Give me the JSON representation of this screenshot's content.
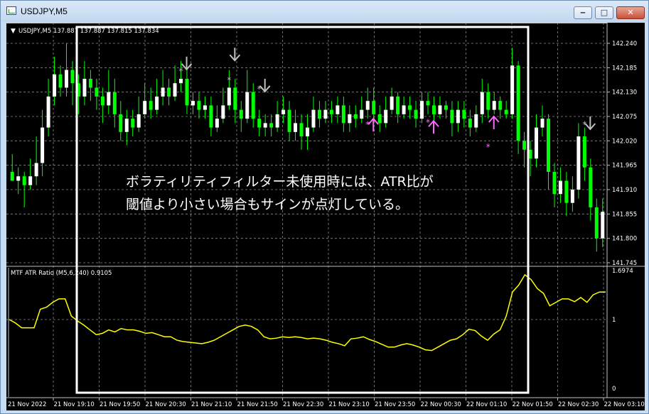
{
  "window": {
    "title": "USDJPY,M5",
    "minimize_glyph": "‒",
    "maximize_glyph": "□",
    "close_glyph": "✕"
  },
  "main_chart": {
    "header": "USDJPY,M5  137.887 137.887 137.815 137.834",
    "price_labels": [
      "142.240",
      "142.185",
      "142.130",
      "142.075",
      "142.020",
      "141.965",
      "141.910",
      "141.855",
      "141.800",
      "141.745"
    ]
  },
  "indicator": {
    "header": "MTF ATR Ratio  (M5,6,240) 0.9105",
    "scale_labels": [
      "1.6974",
      "1",
      "0"
    ],
    "line_color": "#ffff00"
  },
  "time_labels": [
    "21 Nov 2022",
    "21 Nov 19:10",
    "21 Nov 19:50",
    "21 Nov 20:30",
    "21 Nov 21:10",
    "21 Nov 21:50",
    "21 Nov 22:30",
    "21 Nov 23:10",
    "21 Nov 23:50",
    "22 Nov 00:30",
    "22 Nov 01:10",
    "22 Nov 01:50",
    "22 Nov 02:30",
    "22 Nov 03:10"
  ],
  "annotation": {
    "line1": "ボラティリティフィルター未使用時には、ATR比が",
    "line2": "閾値より小さい場合もサインが点灯している。"
  },
  "colors": {
    "bull_candle": "#ffffff",
    "bear_candle": "#00ff00",
    "grid": "#8a8a8a",
    "sell_arrow": "#c0c0c0",
    "buy_arrow": "#ff66ff",
    "highlight_box": "#ffffff"
  },
  "candles": [
    [
      141.95,
      141.93,
      141.99,
      141.93
    ],
    [
      141.93,
      141.94,
      141.96,
      141.9
    ],
    [
      141.94,
      141.92,
      141.95,
      141.87
    ],
    [
      141.92,
      141.94,
      141.98,
      141.91
    ],
    [
      141.94,
      141.97,
      142.03,
      141.92
    ],
    [
      141.97,
      142.05,
      142.09,
      141.94
    ],
    [
      142.05,
      142.12,
      142.16,
      142.03
    ],
    [
      142.12,
      142.17,
      142.21,
      142.1
    ],
    [
      142.17,
      142.14,
      142.19,
      142.12
    ],
    [
      142.14,
      142.18,
      142.24,
      142.12
    ],
    [
      142.18,
      142.15,
      142.2,
      142.1
    ],
    [
      142.15,
      142.12,
      142.17,
      142.08
    ],
    [
      142.12,
      142.16,
      142.2,
      142.1
    ],
    [
      142.16,
      142.14,
      142.18,
      142.11
    ],
    [
      142.14,
      142.12,
      142.16,
      142.09
    ],
    [
      142.12,
      142.1,
      142.14,
      142.06
    ],
    [
      142.1,
      142.13,
      142.18,
      142.08
    ],
    [
      142.13,
      142.08,
      142.16,
      142.05
    ],
    [
      142.08,
      142.04,
      142.11,
      142.02
    ],
    [
      142.04,
      142.07,
      142.09,
      142.01
    ],
    [
      142.07,
      142.05,
      142.09,
      142.03
    ],
    [
      142.05,
      142.08,
      142.12,
      142.04
    ],
    [
      142.08,
      142.11,
      142.15,
      142.07
    ],
    [
      142.11,
      142.09,
      142.14,
      142.07
    ],
    [
      142.09,
      142.12,
      142.16,
      142.08
    ],
    [
      142.12,
      142.14,
      142.18,
      142.1
    ],
    [
      142.14,
      142.12,
      142.16,
      142.1
    ],
    [
      142.12,
      142.15,
      142.19,
      142.11
    ],
    [
      142.15,
      142.16,
      142.2,
      142.13
    ],
    [
      142.16,
      142.1,
      142.18,
      142.08
    ],
    [
      142.1,
      142.11,
      142.13,
      142.08
    ],
    [
      142.11,
      142.09,
      142.13,
      142.07
    ],
    [
      142.09,
      142.1,
      142.12,
      142.07
    ],
    [
      142.1,
      142.05,
      142.12,
      142.03
    ],
    [
      142.05,
      142.07,
      142.1,
      142.04
    ],
    [
      142.07,
      142.1,
      142.14,
      142.06
    ],
    [
      142.1,
      142.14,
      142.18,
      142.09
    ],
    [
      142.14,
      142.09,
      142.16,
      142.06
    ],
    [
      142.09,
      142.07,
      142.11,
      142.04
    ],
    [
      142.07,
      142.13,
      142.18,
      142.06
    ],
    [
      142.13,
      142.07,
      142.15,
      142.05
    ],
    [
      142.07,
      142.05,
      142.09,
      142.03
    ],
    [
      142.05,
      142.06,
      142.08,
      142.03
    ],
    [
      142.06,
      142.05,
      142.08,
      142.03
    ],
    [
      142.05,
      142.08,
      142.11,
      142.04
    ],
    [
      142.08,
      142.09,
      142.12,
      142.06
    ],
    [
      142.09,
      142.04,
      142.11,
      142.02
    ],
    [
      142.04,
      142.06,
      142.09,
      142.02
    ],
    [
      142.06,
      142.03,
      142.08,
      142.0
    ],
    [
      142.03,
      142.05,
      142.08,
      142.0
    ],
    [
      142.05,
      142.09,
      142.12,
      142.04
    ],
    [
      142.09,
      142.07,
      142.11,
      142.05
    ],
    [
      142.07,
      142.09,
      142.11,
      142.06
    ],
    [
      142.09,
      142.08,
      142.11,
      142.06
    ],
    [
      142.08,
      142.1,
      142.12,
      142.06
    ],
    [
      142.1,
      142.06,
      142.12,
      142.04
    ],
    [
      142.06,
      142.08,
      142.1,
      142.04
    ],
    [
      142.08,
      142.07,
      142.1,
      142.05
    ],
    [
      142.07,
      142.09,
      142.12,
      142.06
    ],
    [
      142.09,
      142.11,
      142.14,
      142.07
    ],
    [
      142.11,
      142.08,
      142.14,
      142.06
    ],
    [
      142.08,
      142.06,
      142.1,
      142.04
    ],
    [
      142.06,
      142.09,
      142.12,
      142.05
    ],
    [
      142.09,
      142.12,
      142.14,
      142.08
    ],
    [
      142.12,
      142.08,
      142.13,
      142.06
    ],
    [
      142.08,
      142.1,
      142.12,
      142.07
    ],
    [
      142.1,
      142.09,
      142.12,
      142.07
    ],
    [
      142.09,
      142.07,
      142.11,
      142.05
    ],
    [
      142.07,
      142.11,
      142.13,
      142.06
    ],
    [
      142.11,
      142.1,
      142.13,
      142.08
    ],
    [
      142.1,
      142.08,
      142.12,
      142.06
    ],
    [
      142.08,
      142.1,
      142.12,
      142.07
    ],
    [
      142.1,
      142.09,
      142.11,
      142.07
    ],
    [
      142.09,
      142.06,
      142.11,
      142.03
    ],
    [
      142.06,
      142.09,
      142.11,
      142.04
    ],
    [
      142.09,
      142.07,
      142.11,
      142.05
    ],
    [
      142.07,
      142.05,
      142.09,
      142.03
    ],
    [
      142.05,
      142.08,
      142.1,
      142.04
    ],
    [
      142.08,
      142.13,
      142.16,
      142.06
    ],
    [
      142.13,
      142.09,
      142.15,
      142.07
    ],
    [
      142.09,
      142.11,
      142.13,
      142.08
    ],
    [
      142.11,
      142.09,
      142.12,
      142.07
    ],
    [
      142.09,
      142.08,
      142.11,
      142.07
    ],
    [
      142.08,
      142.19,
      142.23,
      142.07
    ],
    [
      142.19,
      142.02,
      142.2,
      141.99
    ],
    [
      142.02,
      142.0,
      142.04,
      141.96
    ],
    [
      142.0,
      141.98,
      142.02,
      141.94
    ],
    [
      141.98,
      142.05,
      142.08,
      141.96
    ],
    [
      142.05,
      142.07,
      142.1,
      142.03
    ],
    [
      142.07,
      141.95,
      142.08,
      141.91
    ],
    [
      141.95,
      141.9,
      141.97,
      141.87
    ],
    [
      141.9,
      141.93,
      141.96,
      141.88
    ],
    [
      141.93,
      141.88,
      141.95,
      141.85
    ],
    [
      141.88,
      141.91,
      141.94,
      141.86
    ],
    [
      141.91,
      142.03,
      142.06,
      141.89
    ],
    [
      142.03,
      141.96,
      142.05,
      141.93
    ],
    [
      141.96,
      141.87,
      141.98,
      141.84
    ],
    [
      141.87,
      141.8,
      141.89,
      141.77
    ],
    [
      141.8,
      141.86,
      141.89,
      141.78
    ]
  ],
  "atr_ratio": [
    1.0,
    0.95,
    0.88,
    0.88,
    0.88,
    1.15,
    1.18,
    1.25,
    1.3,
    1.3,
    1.05,
    0.98,
    0.92,
    0.85,
    0.78,
    0.8,
    0.85,
    0.82,
    0.87,
    0.85,
    0.85,
    0.83,
    0.8,
    0.81,
    0.78,
    0.75,
    0.75,
    0.7,
    0.68,
    0.67,
    0.66,
    0.65,
    0.67,
    0.7,
    0.75,
    0.8,
    0.85,
    0.9,
    0.92,
    0.9,
    0.85,
    0.75,
    0.72,
    0.73,
    0.75,
    0.74,
    0.75,
    0.74,
    0.72,
    0.73,
    0.72,
    0.7,
    0.67,
    0.65,
    0.62,
    0.72,
    0.73,
    0.75,
    0.71,
    0.68,
    0.64,
    0.6,
    0.6,
    0.63,
    0.65,
    0.63,
    0.6,
    0.56,
    0.55,
    0.6,
    0.65,
    0.7,
    0.72,
    0.78,
    0.86,
    0.84,
    0.76,
    0.7,
    0.79,
    0.85,
    1.05,
    1.4,
    1.5,
    1.65,
    1.58,
    1.45,
    1.38,
    1.2,
    1.25,
    1.3,
    1.3,
    1.26,
    1.32,
    1.25,
    1.36,
    1.4,
    1.4
  ]
}
